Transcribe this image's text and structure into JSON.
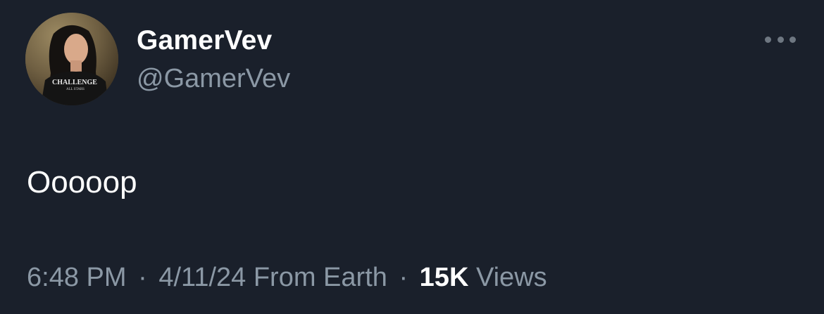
{
  "tweet": {
    "display_name": "GamerVev",
    "handle": "@GamerVev",
    "text": "Ooooop",
    "time": "6:48 PM",
    "separator": "·",
    "date": "4/11/24",
    "source": "From Earth",
    "views_count": "15K",
    "views_label": "Views",
    "avatar_shirt_text": "CHALLENGE",
    "avatar_shirt_subtext": "ALL STARS"
  },
  "icons": {
    "more": "more-horizontal-icon"
  },
  "colors": {
    "background": "#1a202b",
    "primary_text": "#ffffff",
    "secondary_text": "#8b98a5",
    "more_dots": "#6e7781"
  }
}
